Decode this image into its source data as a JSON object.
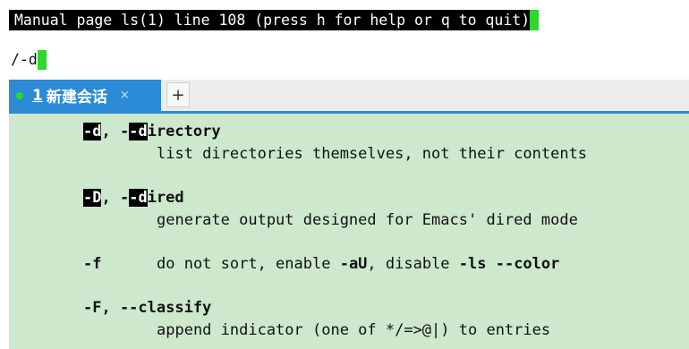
{
  "pager": {
    "status_text": "Manual page ls(1) line 108 (press h for help or q to quit)",
    "search_text": "/-d"
  },
  "tabs": [
    {
      "number": "1",
      "label": "新建会话",
      "close_glyph": "×"
    }
  ],
  "tab_add_glyph": "+",
  "man": {
    "d_opt": {
      "part1": "-d",
      "part2": ", -",
      "part3": "-d",
      "part4": "irectory",
      "desc": "list directories themselves, not their contents"
    },
    "D_opt": {
      "part1": "-D",
      "part2": ", -",
      "part3": "-d",
      "part4": "ired",
      "desc": "generate output designed for Emacs' dired mode"
    },
    "f_opt": {
      "flag": "-f",
      "desc_a": "do not sort, enable ",
      "desc_b": "-aU",
      "desc_c": ", disable ",
      "desc_d": "-ls --color"
    },
    "F_opt": {
      "flag": "-F, --classify",
      "desc": "append indicator (one of */=>@|) to entries"
    }
  },
  "colors": {
    "terminal_bg": "#cde8cd",
    "tab_active": "#2b8bd6",
    "cursor": "#2bd92b"
  }
}
